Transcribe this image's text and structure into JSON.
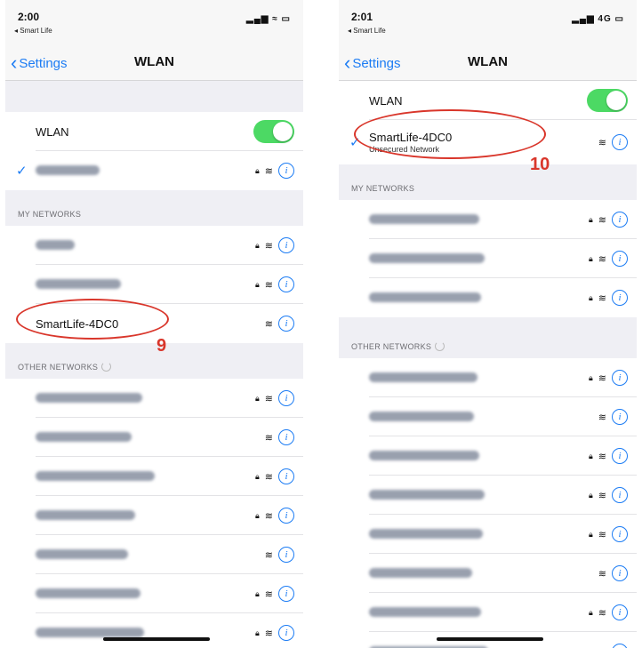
{
  "left": {
    "status": {
      "time": "2:00",
      "back_app": "◂ Smart Life",
      "icons": "▂▄▆ ≈ ▭"
    },
    "nav": {
      "back": "Settings",
      "title": "WLAN"
    },
    "wlan_label": "WLAN",
    "my_networks_header": "MY NETWORKS",
    "my_networks": [
      {
        "label": "",
        "lock": true
      },
      {
        "label": "",
        "lock": true
      },
      {
        "label": "SmartLife-4DC0",
        "lock": false
      }
    ],
    "other_header": "OTHER NETWORKS",
    "other_networks": [
      {
        "lock": true
      },
      {
        "lock": false
      },
      {
        "lock": true
      },
      {
        "lock": true
      },
      {
        "lock": false
      },
      {
        "lock": true
      },
      {
        "lock": true
      }
    ],
    "step": "9"
  },
  "right": {
    "status": {
      "time": "2:01",
      "back_app": "◂ Smart Life",
      "icons": "▂▄▆ 4G ▭"
    },
    "nav": {
      "back": "Settings",
      "title": "WLAN"
    },
    "wlan_label": "WLAN",
    "connected": {
      "label": "SmartLife-4DC0",
      "sub": "Unsecured Network"
    },
    "my_networks_header": "MY NETWORKS",
    "other_header": "OTHER NETWORKS",
    "step": "10"
  },
  "icons": {
    "check": "check-icon",
    "lock": "lock-icon",
    "wifi": "wifi-icon",
    "info": "info-icon"
  },
  "colors": {
    "accent": "#1c7cf4",
    "toggle_on": "#4cd964",
    "annotation": "#d9362b"
  }
}
